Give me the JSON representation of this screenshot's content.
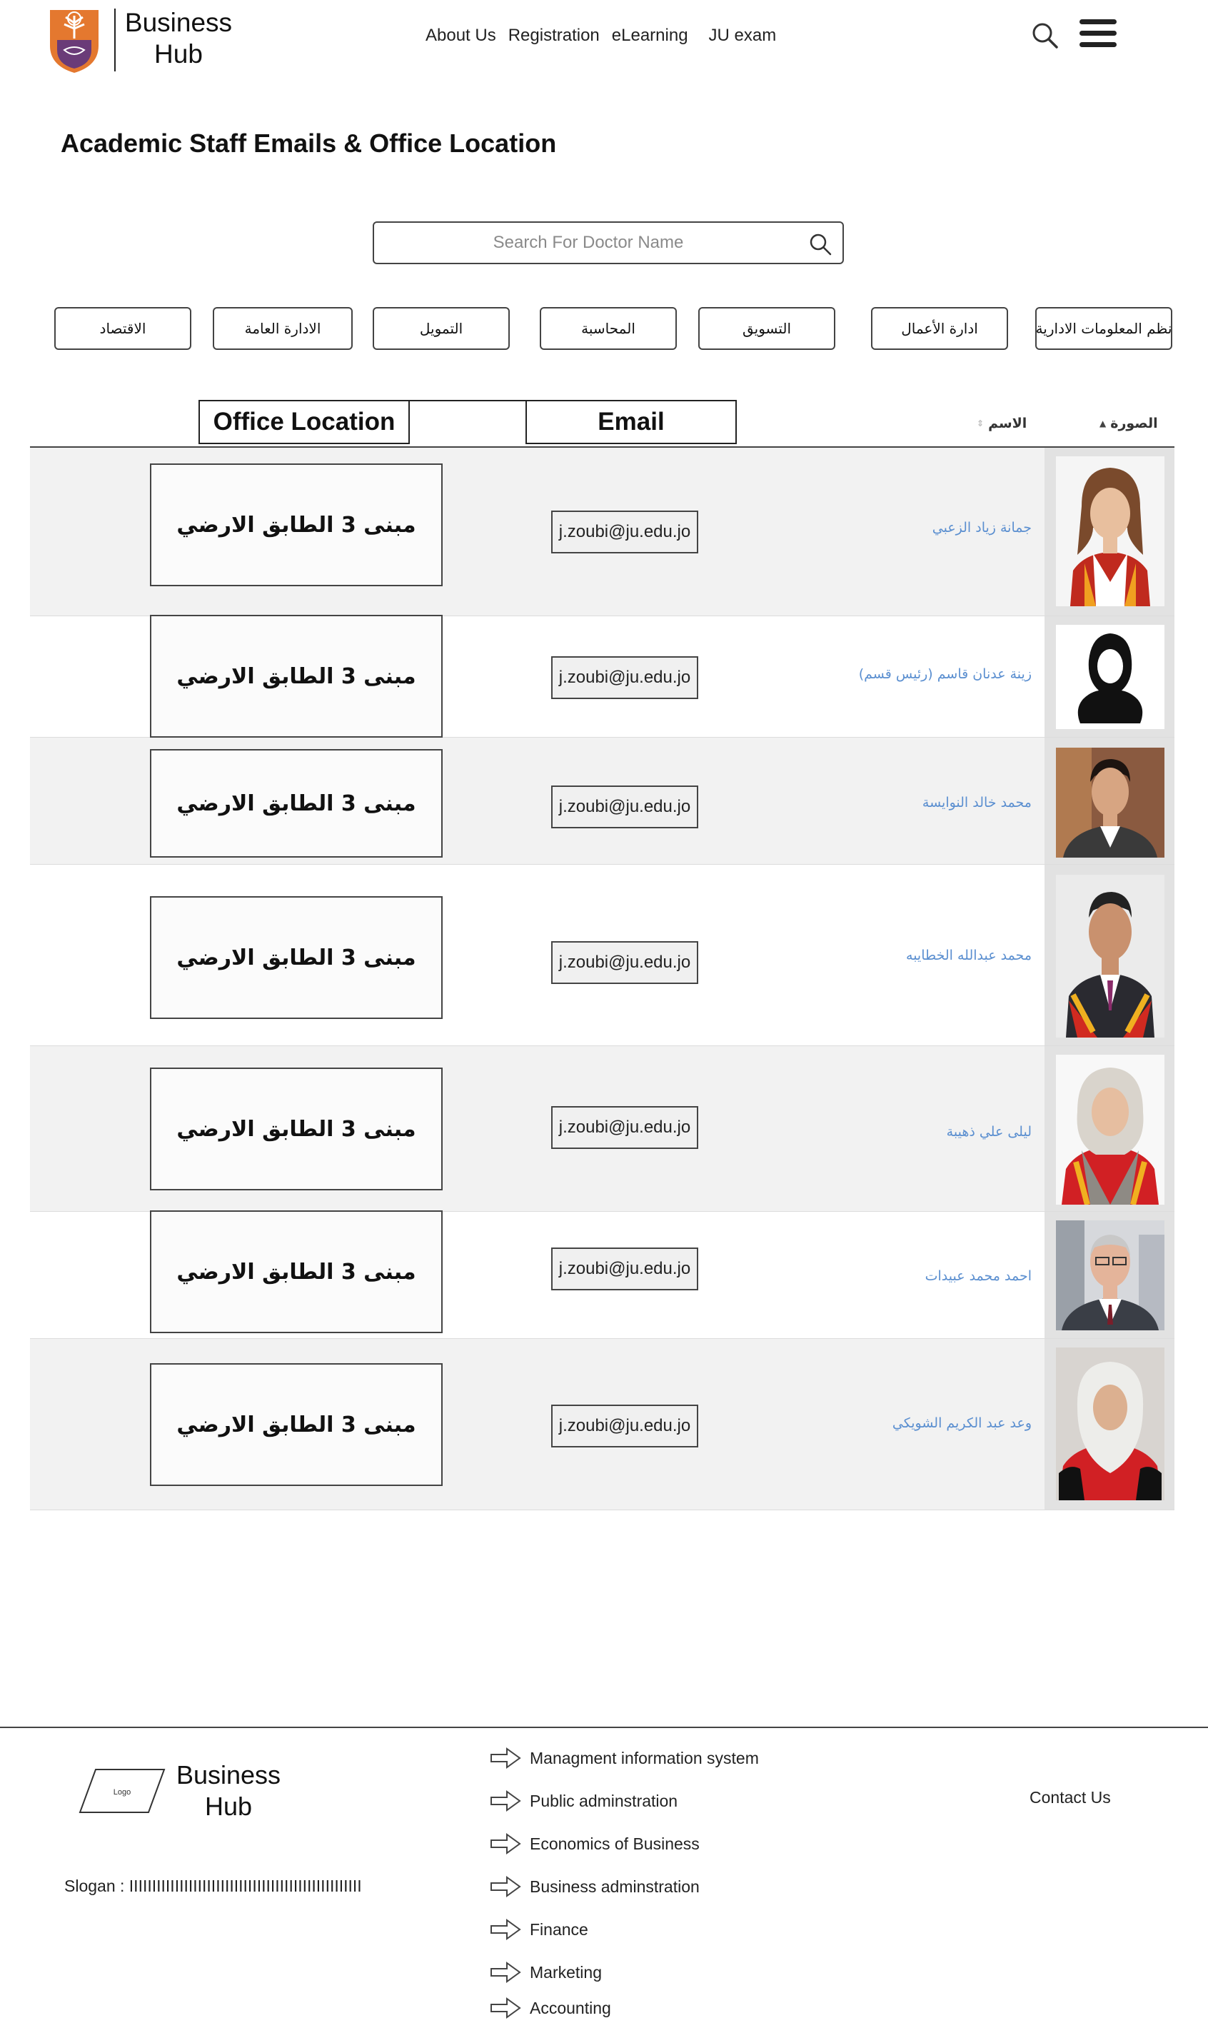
{
  "header": {
    "brand_line1": "Business",
    "brand_line2": "Hub",
    "nav": [
      "About Us",
      "Registration",
      "eLearning",
      "JU exam"
    ]
  },
  "page_title": "Academic Staff Emails & Office Location",
  "search": {
    "placeholder": "Search For Doctor Name"
  },
  "departments": [
    "نظم المعلومات الادارية",
    "ادارة الأعمال",
    "التسويق",
    "المحاسبة",
    "التمويل",
    "الادارة العامة",
    "الاقتصاد"
  ],
  "table": {
    "col_office": "Office Location",
    "col_email": "Email",
    "col_photo": "الصورة",
    "col_name": "الاسم",
    "rows": [
      {
        "name": "جمانة زياد الزعبي",
        "email": "j.zoubi@ju.edu.jo",
        "office": "مبنى 3 الطابق الارضي"
      },
      {
        "name": "زينة عدنان قاسم (رئيس قسم)",
        "email": "j.zoubi@ju.edu.jo",
        "office": "مبنى 3 الطابق الارضي"
      },
      {
        "name": "محمد خالد النوايسة",
        "email": "j.zoubi@ju.edu.jo",
        "office": "مبنى 3 الطابق الارضي"
      },
      {
        "name": "محمد عبدالله الخطايبه",
        "email": "j.zoubi@ju.edu.jo",
        "office": "مبنى 3 الطابق الارضي"
      },
      {
        "name": "ليلى علي ذهيبة",
        "email": "j.zoubi@ju.edu.jo",
        "office": "مبنى 3 الطابق الارضي"
      },
      {
        "name": "احمد محمد عبيدات",
        "email": "j.zoubi@ju.edu.jo",
        "office": "مبنى 3 الطابق الارضي"
      },
      {
        "name": "وعد عبد الكريم الشويكي",
        "email": "j.zoubi@ju.edu.jo",
        "office": "مبنى 3 الطابق الارضي"
      }
    ]
  },
  "footer": {
    "logo_label": "Logo",
    "brand_line1": "Business",
    "brand_line2": "Hub",
    "slogan": "Slogan  : IIIIIIIIIIIIIIIIIIIIIIIIIIIIIIIIIIIIIIIIIIIIIIIIIII",
    "links": [
      "Managment information system",
      "Public adminstration",
      "Economics of Business",
      "Business adminstration",
      "Finance",
      "Marketing",
      "Accounting"
    ],
    "contact": "Contact Us"
  }
}
